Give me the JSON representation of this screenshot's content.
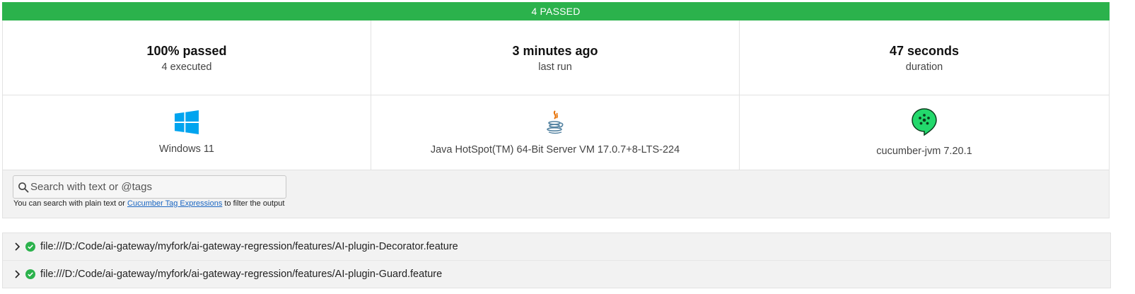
{
  "banner": {
    "text": "4 PASSED",
    "color": "#2bb24c"
  },
  "stats": [
    {
      "main": "100% passed",
      "sub": "4 executed"
    },
    {
      "main": "3 minutes ago",
      "sub": "last run"
    },
    {
      "main": "47 seconds",
      "sub": "duration"
    }
  ],
  "environment": [
    {
      "icon": "windows-logo-icon",
      "label": "Windows 11"
    },
    {
      "icon": "java-logo-icon",
      "label": "Java HotSpot(TM) 64-Bit Server VM 17.0.7+8-LTS-224"
    },
    {
      "icon": "cucumber-logo-icon",
      "label": "cucumber-jvm 7.20.1"
    }
  ],
  "search": {
    "placeholder": "Search with text or @tags",
    "value": "",
    "help_prefix": "You can search with plain text or ",
    "help_link": "Cucumber Tag Expressions",
    "help_suffix": " to filter the output"
  },
  "features": [
    {
      "uri": "file:///D:/Code/ai-gateway/myfork/ai-gateway-regression/features/AI-plugin-Decorator.feature",
      "status": "passed"
    },
    {
      "uri": "file:///D:/Code/ai-gateway/myfork/ai-gateway-regression/features/AI-plugin-Guard.feature",
      "status": "passed"
    }
  ],
  "colors": {
    "pass": "#2bb24c",
    "link": "#1a66c2",
    "windows": "#00a4ef",
    "cucumber": "#23d96c"
  }
}
